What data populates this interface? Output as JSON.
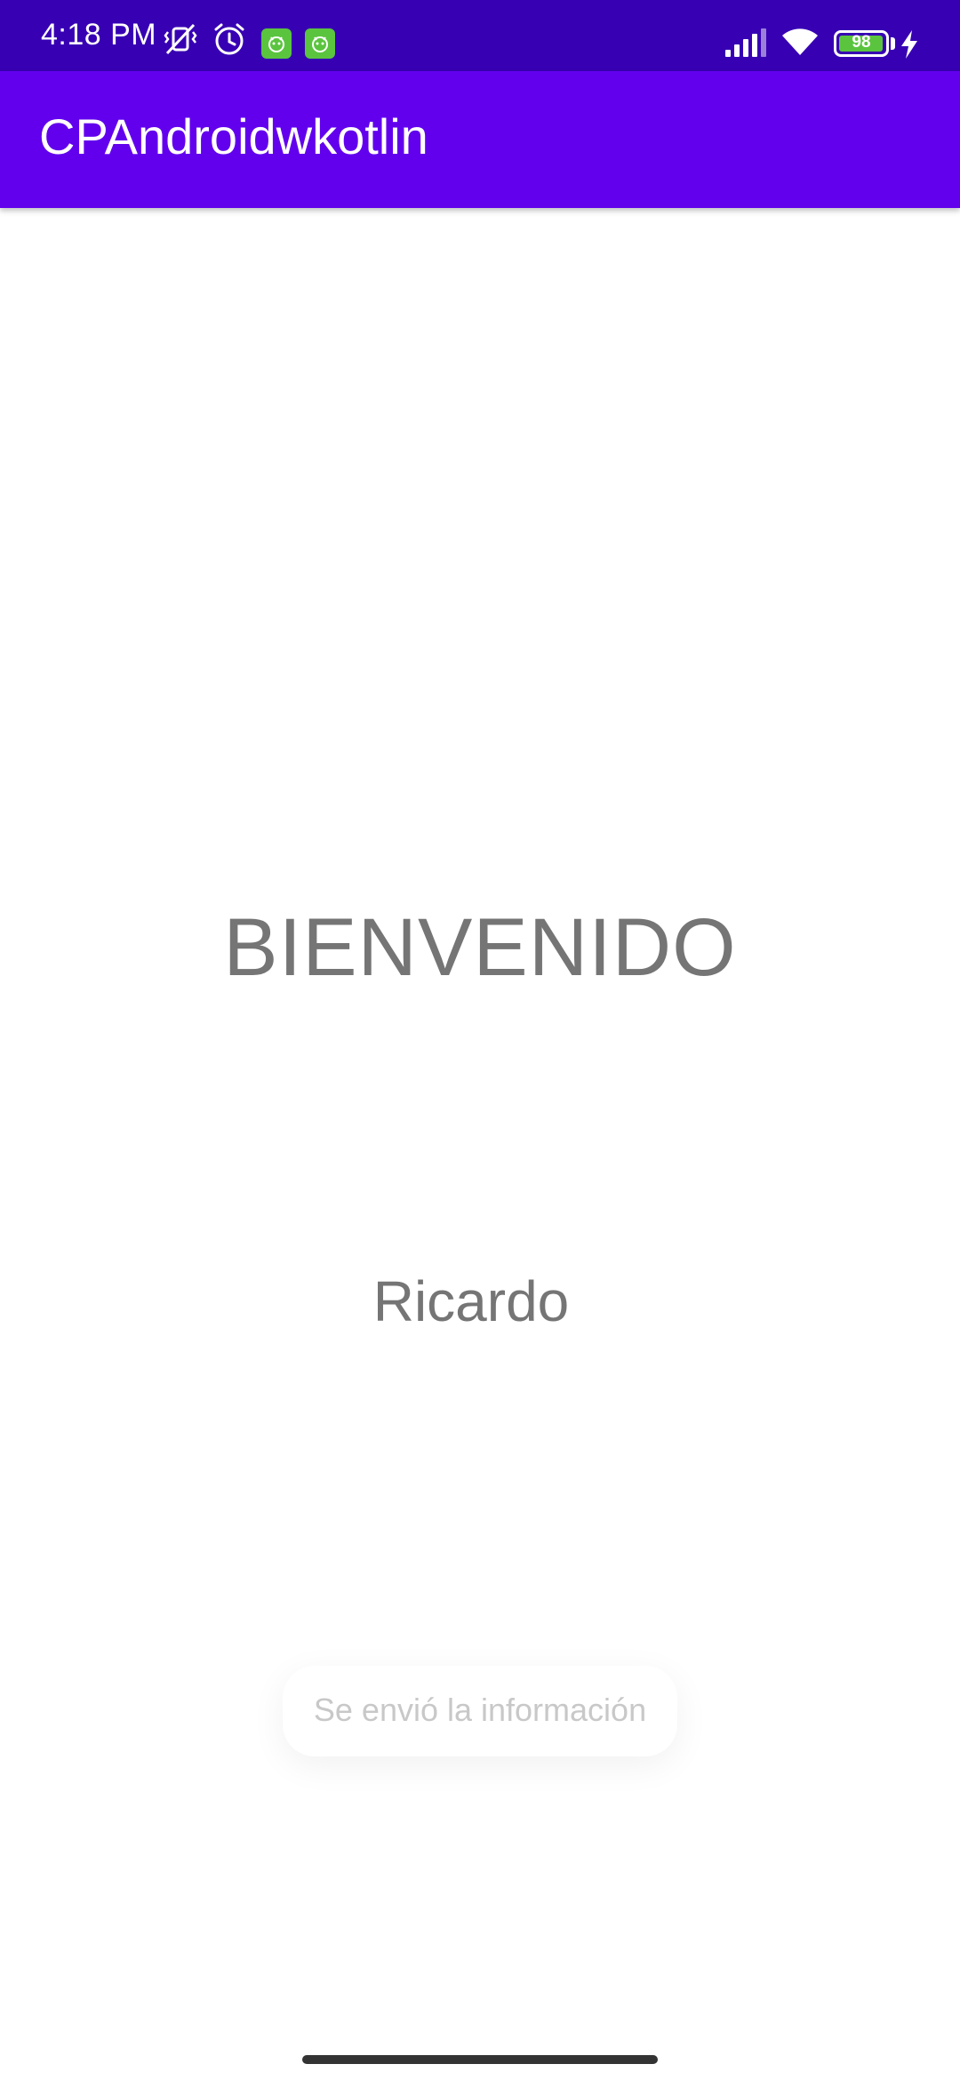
{
  "status_bar": {
    "time": "4:18 PM",
    "battery_level": "98",
    "icons": [
      "mute-vibrate-icon",
      "alarm-icon",
      "app-notification-icon",
      "app-notification-icon",
      "signal-icon",
      "wifi-icon",
      "battery-icon",
      "charging-icon"
    ],
    "background_color": "#3700B3"
  },
  "app_bar": {
    "title": "CPAndroidwkotlin",
    "background_color": "#6200EE"
  },
  "main": {
    "welcome": "BIENVENIDO",
    "name": "Ricardo"
  },
  "toast": {
    "message": "Se envió la información"
  },
  "colors": {
    "text_secondary": "#757575",
    "notification_green": "#5BC43F"
  }
}
